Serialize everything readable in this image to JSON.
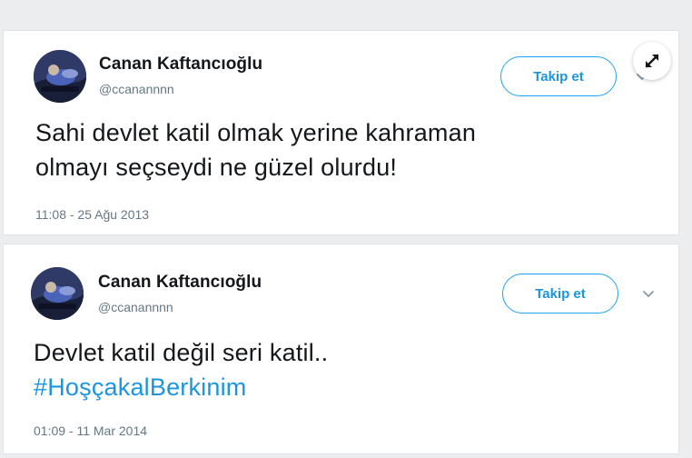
{
  "tweets": [
    {
      "display_name": "Canan Kaftancıoğlu",
      "handle": "@ccanannnn",
      "follow_label": "Takip et",
      "text_lines": [
        "Sahi devlet katil olmak yerine kahraman",
        "olmayı seçseydi ne güzel olurdu!"
      ],
      "timestamp": "11:08 - 25 Ağu 2013"
    },
    {
      "display_name": "Canan Kaftancıoğlu",
      "handle": "@ccanannnn",
      "follow_label": "Takip et",
      "text_lines": [
        "Devlet katil değil seri katil.."
      ],
      "hashtag": "#HoşçakalBerkinim",
      "timestamp": "01:09 - 11 Mar 2014"
    }
  ],
  "icons": {
    "expand": "expand-arrows-icon",
    "menu": "chevron-down-icon",
    "avatar": "profile-photo"
  },
  "colors": {
    "accent": "#1da1f2",
    "link": "#1b95e0",
    "text": "#14171a",
    "muted": "#657786",
    "background": "#ecedef"
  }
}
